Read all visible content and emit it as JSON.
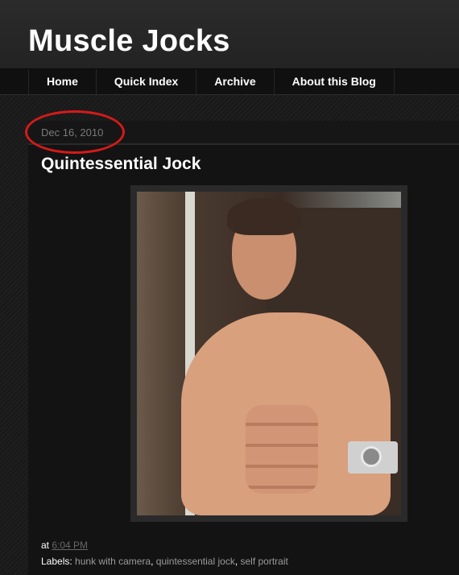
{
  "blog": {
    "title": "Muscle Jocks"
  },
  "nav": {
    "items": [
      {
        "label": "Home"
      },
      {
        "label": "Quick Index"
      },
      {
        "label": "Archive"
      },
      {
        "label": "About this Blog"
      }
    ]
  },
  "post": {
    "date": "Dec 16, 2010",
    "title": "Quintessential Jock",
    "at_label": "at",
    "time": "6:04 PM",
    "labels_prefix": "Labels:",
    "labels": [
      {
        "text": "hunk with camera"
      },
      {
        "text": "quintessential jock"
      },
      {
        "text": "self portrait"
      }
    ],
    "label_separator": ", "
  },
  "annotation": {
    "circle_color": "#d41a1a"
  }
}
